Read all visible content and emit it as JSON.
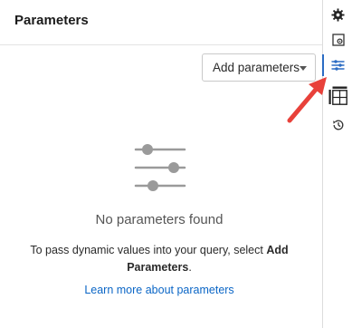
{
  "panel": {
    "title": "Parameters",
    "add_button_label": "Add parameters",
    "empty_state": {
      "icon": "sliders-icon",
      "title": "No parameters found",
      "description_prefix": "To pass dynamic values into your query, select ",
      "description_bold": "Add Parameters",
      "description_suffix": ".",
      "link_text": "Learn more about parameters"
    }
  },
  "rail": {
    "items": [
      {
        "icon": "gear-icon"
      },
      {
        "icon": "settings-panel-icon"
      },
      {
        "icon": "parameters-icon",
        "active": true
      },
      {
        "icon": "table-layout-icon"
      },
      {
        "icon": "history-icon"
      }
    ]
  },
  "colors": {
    "accent": "#2b6cc4",
    "link": "#0b66c6",
    "annotation": "#e8413a"
  }
}
